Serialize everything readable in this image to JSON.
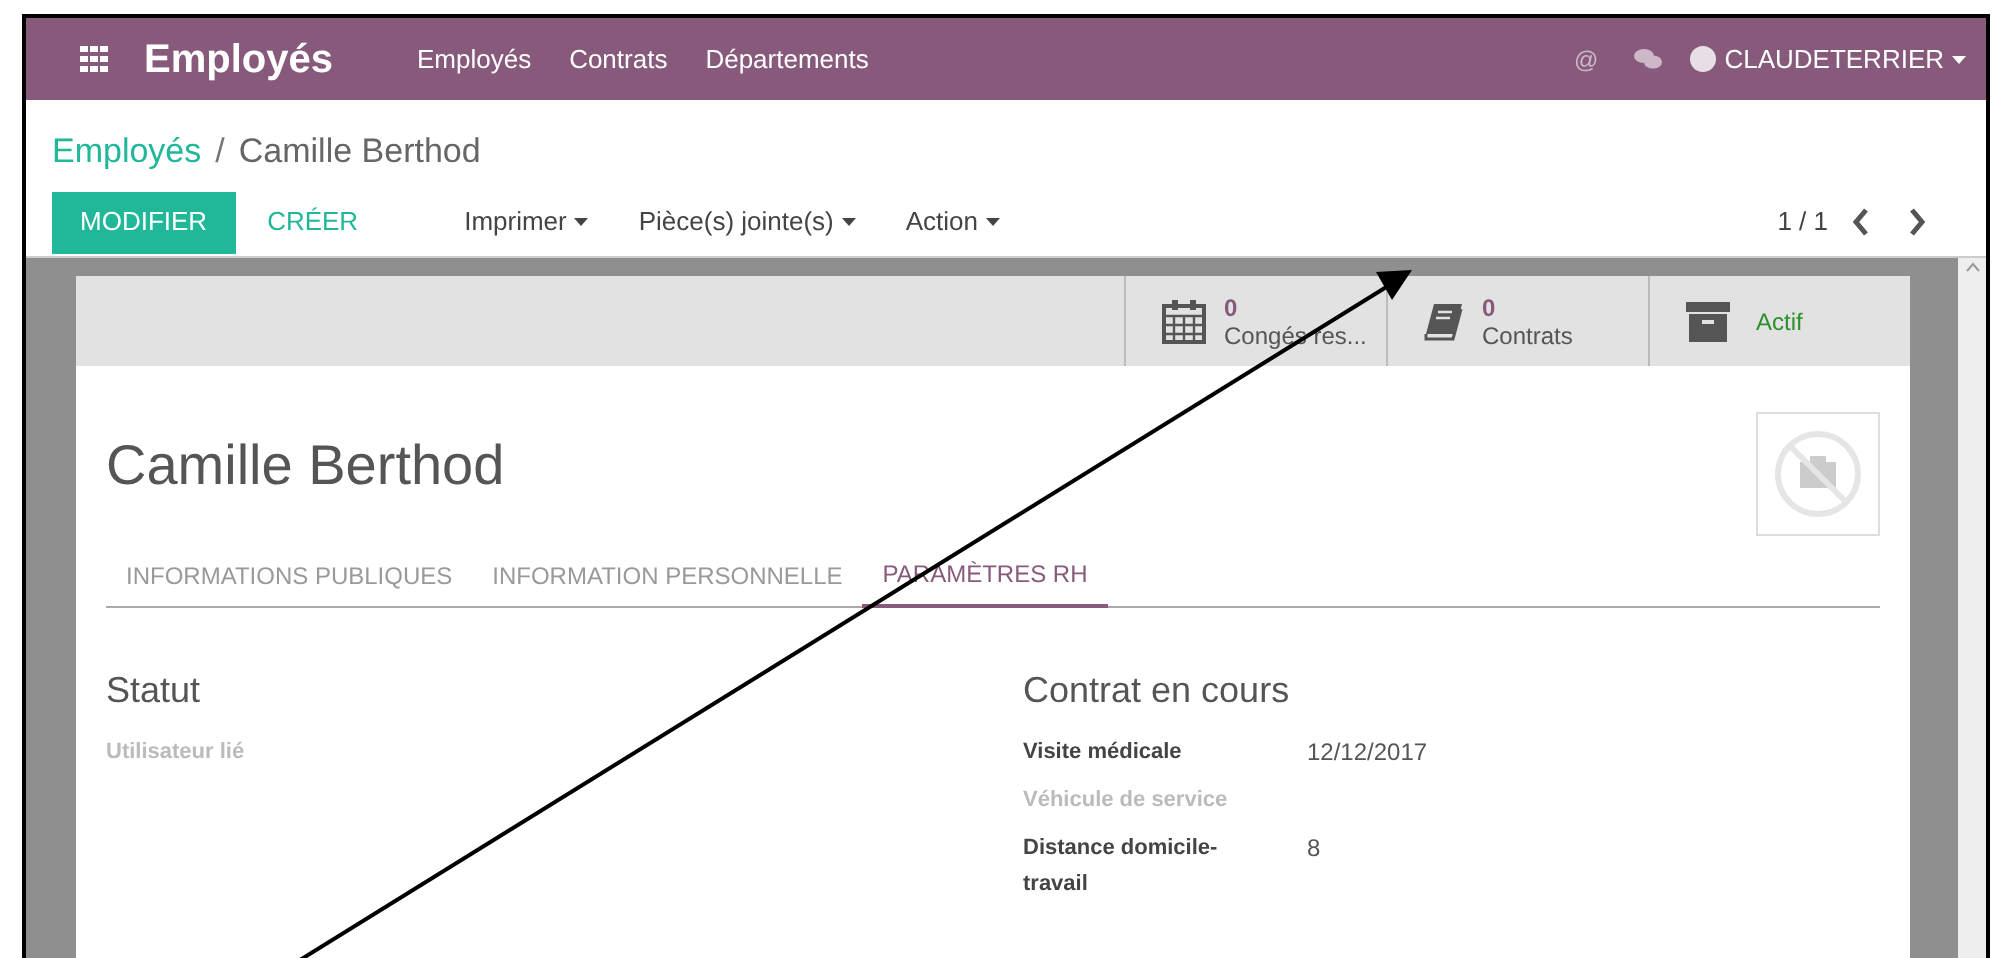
{
  "navbar": {
    "mention": "@",
    "app_title": "Employés",
    "menu": [
      "Employés",
      "Contrats",
      "Départements"
    ],
    "user": "CLAUDETERRIER"
  },
  "breadcrumb": {
    "parent": "Employés",
    "separator": "/",
    "current": "Camille Berthod"
  },
  "buttons": {
    "edit": "MODIFIER",
    "create": "CRÉER"
  },
  "dropdowns": [
    "Imprimer",
    "Pièce(s) jointe(s)",
    "Action"
  ],
  "pager": "1 / 1",
  "smart_buttons": [
    {
      "kind": "stat",
      "count": "0",
      "label": "Congés res..."
    },
    {
      "kind": "stat",
      "count": "0",
      "label": "Contrats"
    },
    {
      "kind": "toggle",
      "label": "Actif"
    }
  ],
  "employee_name": "Camille Berthod",
  "tabs": [
    {
      "label": "INFORMATIONS PUBLIQUES",
      "selected": false
    },
    {
      "label": "INFORMATION PERSONNELLE",
      "selected": false
    },
    {
      "label": "PARAMÈTRES RH",
      "selected": true
    }
  ],
  "sections": [
    {
      "title": "Statut",
      "fields": [
        {
          "label": "Utilisateur lié",
          "empty": true
        }
      ]
    },
    {
      "title": "Contrat en cours",
      "fields": [
        {
          "label": "Visite médicale",
          "empty": false,
          "value": "12/12/2017"
        },
        {
          "label": "Véhicule de service",
          "empty": true
        },
        {
          "label": "Distance domicile-travail",
          "empty": false,
          "value": "8"
        }
      ]
    }
  ]
}
